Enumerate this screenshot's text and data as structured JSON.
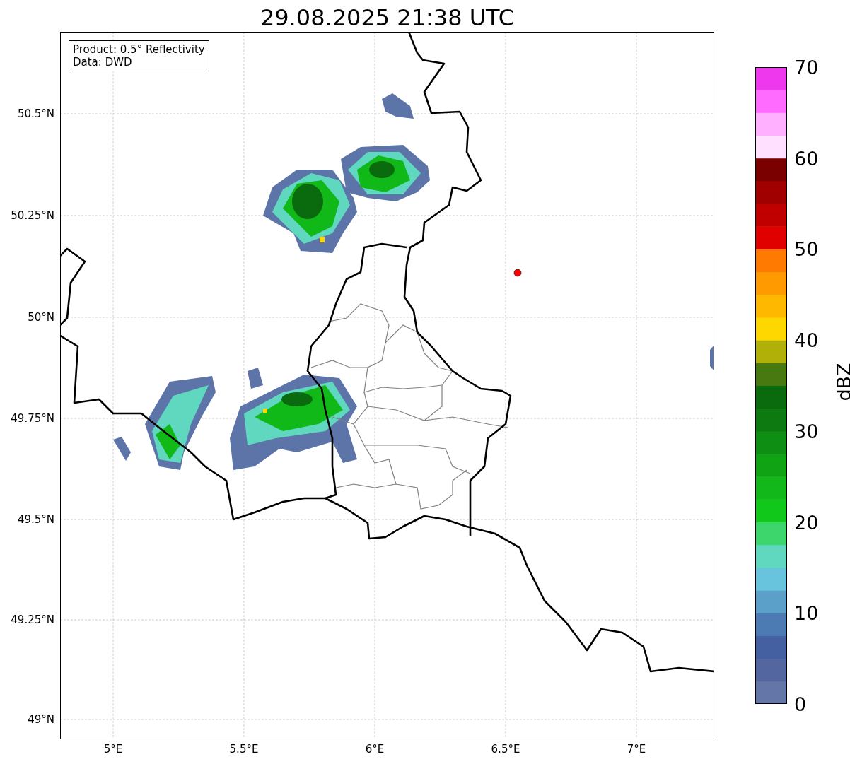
{
  "title": "29.08.2025 21:38 UTC",
  "info_box": [
    "Product: 0.5° Reflectivity",
    "Data: DWD"
  ],
  "lat_ticks": [
    "50.5°N",
    "50.25°N",
    "50°N",
    "49.75°N",
    "49.5°N",
    "49.25°N",
    "49°N"
  ],
  "lon_ticks": [
    "5°E",
    "5.5°E",
    "6°E",
    "6.5°E",
    "7°E"
  ],
  "colorbar": {
    "label": "dBZ",
    "ticks": [
      "70",
      "60",
      "50",
      "40",
      "30",
      "20",
      "10",
      "0"
    ]
  }
}
